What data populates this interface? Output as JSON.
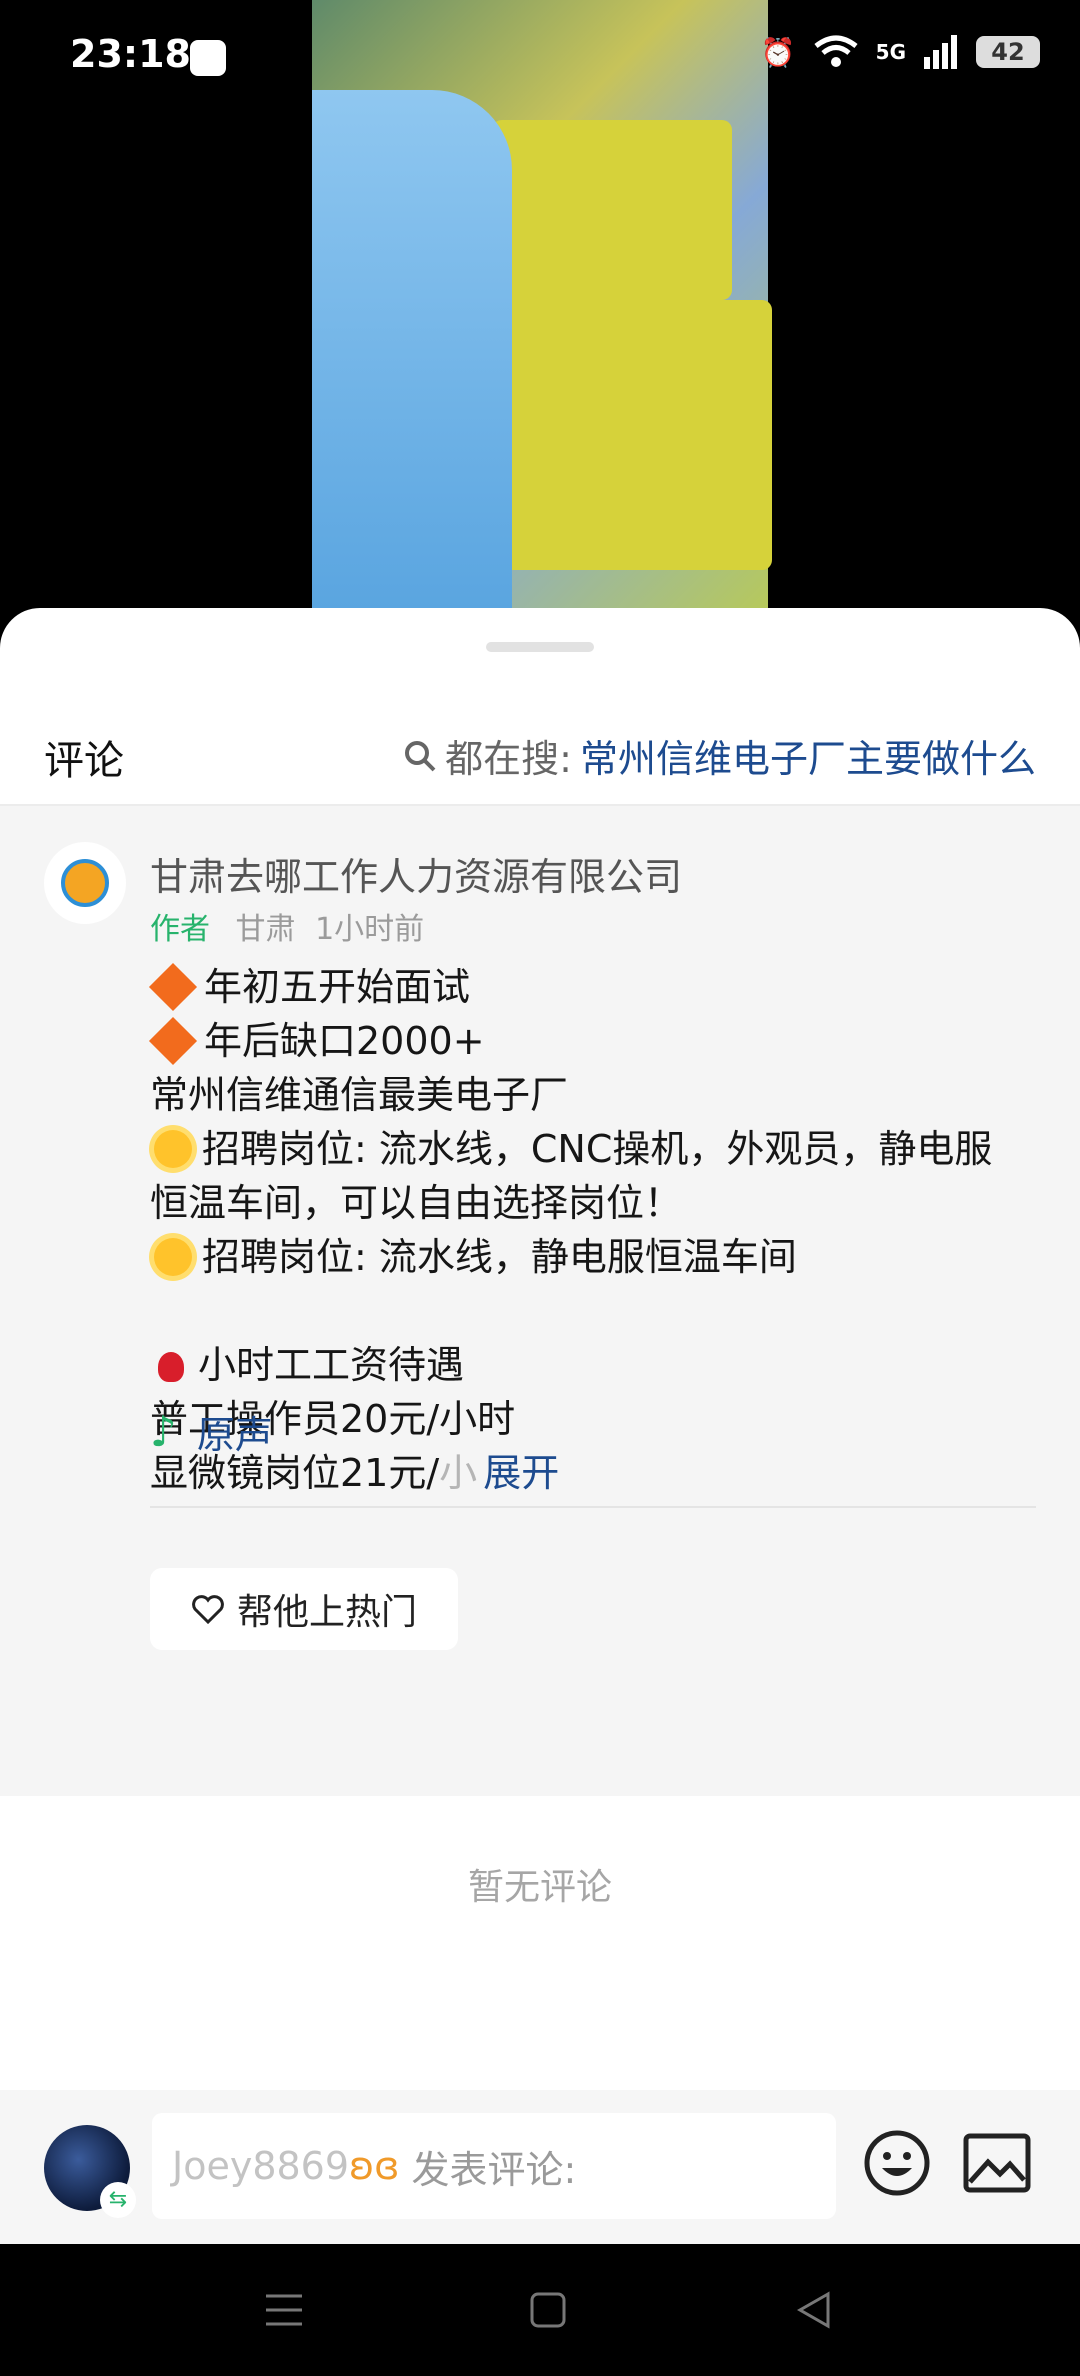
{
  "status_bar": {
    "time": "23:18",
    "network": "5G",
    "battery": "42"
  },
  "sheet": {
    "title": "评论",
    "search_prefix": "都在搜:",
    "search_query": "常州信维电子厂主要做什么"
  },
  "post": {
    "author_name": "甘肃去哪工作人力资源有限公司",
    "author_tag": "作者",
    "location": "甘肃",
    "time_ago": "1小时前",
    "lines": [
      "年初五开始面试",
      "年后缺口2000+",
      "常州信维通信最美电子厂",
      "招聘岗位: 流水线，CNC操机，外观员，静电服",
      "恒温车间，可以自由选择岗位！",
      "招聘岗位: 流水线，静电服恒温车间",
      "小时工工资待遇",
      "普工操作员20元/小时",
      "显微镜岗位21元/",
      "小"
    ],
    "expand_label": "展开",
    "music_label": "原声",
    "boost_label": "帮他上热门"
  },
  "empty_label": "暂无评论",
  "input": {
    "username": "Joey8869",
    "placeholder": "发表评论:"
  },
  "colors": {
    "accent_blue": "#1d4b8f",
    "green": "#27b36c"
  }
}
